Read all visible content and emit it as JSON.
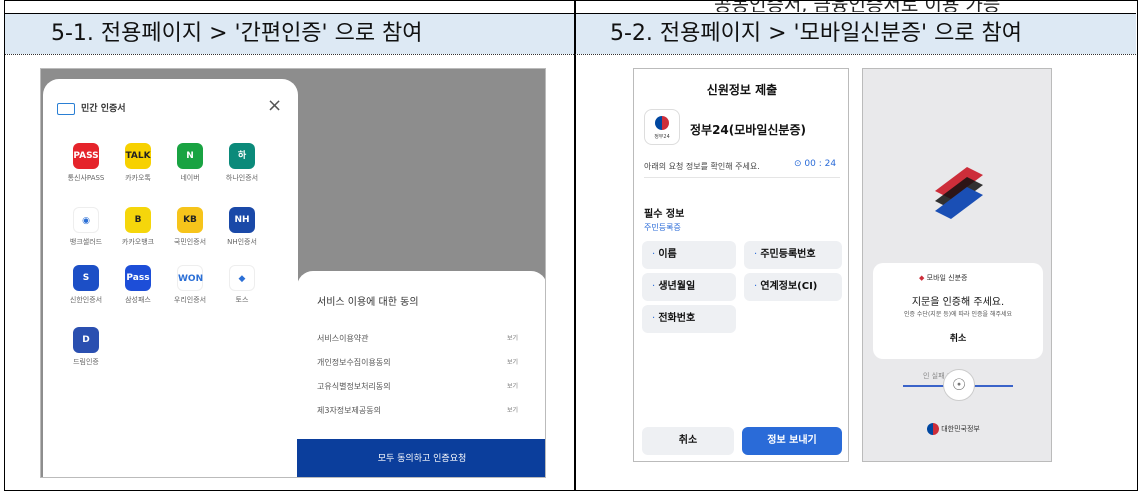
{
  "top_strip": "공동인증서, 금융인증서로 이용 가능",
  "headers": {
    "left": "5-1. 전용페이지 > '간편인증' 으로 참여",
    "right": "5-2. 전용페이지 > '모바일신분증' 으로 참여"
  },
  "cert_modal": {
    "title": "민간 인증서",
    "close": "×",
    "providers": [
      {
        "label": "통신사PASS",
        "icon_text": "PASS",
        "color": "#e5242b"
      },
      {
        "label": "카카오톡",
        "icon_text": "TALK",
        "color": "#f7d100"
      },
      {
        "label": "네이버",
        "icon_text": "N",
        "color": "#19a342"
      },
      {
        "label": "하나인증서",
        "icon_text": "하",
        "color": "#0b8a7a"
      },
      {
        "label": "뱅크샐러드",
        "icon_text": "◉",
        "color": "#ffffff"
      },
      {
        "label": "카카오뱅크",
        "icon_text": "B",
        "color": "#f5d60b"
      },
      {
        "label": "국민인증서",
        "icon_text": "KB",
        "color": "#f6c41b"
      },
      {
        "label": "NH인증서",
        "icon_text": "NH",
        "color": "#1a49a8"
      },
      {
        "label": "신한인증서",
        "icon_text": "S",
        "color": "#1c4fc6"
      },
      {
        "label": "삼성패스",
        "icon_text": "Pass",
        "color": "#1d4ed8"
      },
      {
        "label": "우리인증서",
        "icon_text": "WON",
        "color": "#ffffff"
      },
      {
        "label": "토스",
        "icon_text": "◆",
        "color": "#ffffff"
      },
      {
        "label": "드림인증",
        "icon_text": "D",
        "color": "#2a4fb0"
      }
    ]
  },
  "consent": {
    "title": "서비스 이용에 대한 동의",
    "items": [
      "서비스이용약관",
      "개인정보수집이용동의",
      "고유식별정보처리동의",
      "제3자정보제공동의"
    ],
    "view": "보기",
    "cta": "모두 동의하고 인증요청"
  },
  "id_submit": {
    "title": "신원정보 제출",
    "agency": "정부24(모바일신분증)",
    "logo_caption": "정부24",
    "instruction": "아래의 요청 정보를 확인해 주세요.",
    "timer": "00 : 24",
    "section": "필수 정보",
    "subsection": "주민등록증",
    "fields": [
      "이름",
      "주민등록번호",
      "생년월일",
      "연계정보(CI)",
      "전화번호"
    ],
    "cancel": "취소",
    "send": "정보 보내기"
  },
  "mobile_id": {
    "app_name": "모바일 신분증",
    "auth_title": "지문을 인증해 주세요.",
    "auth_desc": "인증 수단(지문 등)에 따라 인증을 해주세요",
    "cancel": "취소",
    "progress_text": "인 실패 100%",
    "gov": "대한민국정부"
  }
}
